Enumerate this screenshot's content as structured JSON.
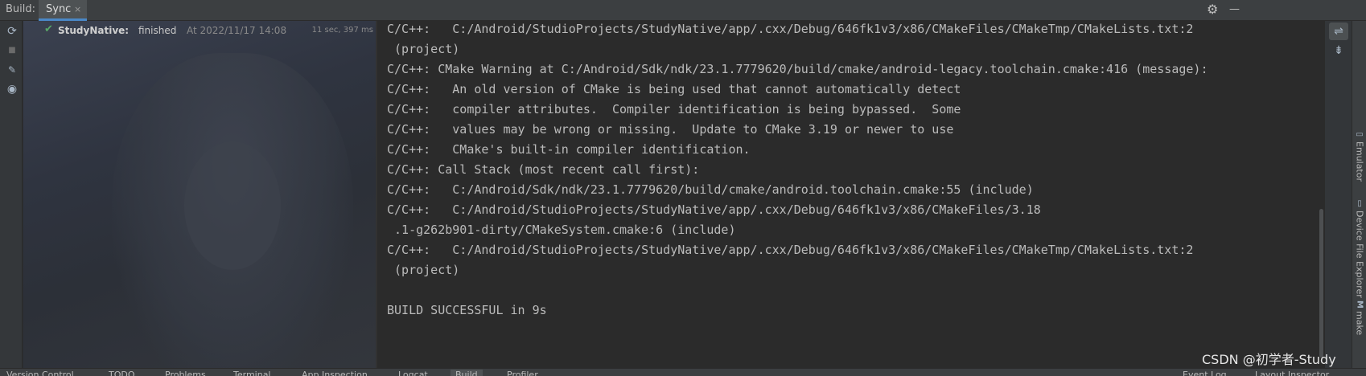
{
  "header": {
    "title": "Build:",
    "tab_label": "Sync",
    "tab_close": "×",
    "settings_icon": "⚙",
    "minimize_icon": "—"
  },
  "left_toolbar": {
    "icons": [
      "sync-icon",
      "stop-icon",
      "pin-icon",
      "eye-icon"
    ],
    "glyphs": [
      "⟳",
      "■",
      "📌",
      "👁"
    ]
  },
  "tree": {
    "check": "✔",
    "project": "StudyNative:",
    "status": "finished",
    "timestamp": "At 2022/11/17 14:08",
    "duration": "11 sec, 397 ms"
  },
  "console": {
    "lines": [
      "C/C++:   C:/Android/StudioProjects/StudyNative/app/.cxx/Debug/646fk1v3/x86/CMakeFiles/CMakeTmp/CMakeLists.txt:2",
      " (project)",
      "C/C++: CMake Warning at C:/Android/Sdk/ndk/23.1.7779620/build/cmake/android-legacy.toolchain.cmake:416 (message):",
      "C/C++:   An old version of CMake is being used that cannot automatically detect",
      "C/C++:   compiler attributes.  Compiler identification is being bypassed.  Some",
      "C/C++:   values may be wrong or missing.  Update to CMake 3.19 or newer to use",
      "C/C++:   CMake's built-in compiler identification.",
      "C/C++: Call Stack (most recent call first):",
      "C/C++:   C:/Android/Sdk/ndk/23.1.7779620/build/cmake/android.toolchain.cmake:55 (include)",
      "C/C++:   C:/Android/StudioProjects/StudyNative/app/.cxx/Debug/646fk1v3/x86/CMakeFiles/3.18",
      " .1-g262b901-dirty/CMakeSystem.cmake:6 (include)",
      "C/C++:   C:/Android/StudioProjects/StudyNative/app/.cxx/Debug/646fk1v3/x86/CMakeFiles/CMakeTmp/CMakeLists.txt:2",
      " (project)",
      "",
      "BUILD SUCCESSFUL in 9s"
    ]
  },
  "right_mini": {
    "soft_wrap_icon": "⇌",
    "scroll_to_end_icon": "⇟"
  },
  "side_tabs": {
    "emulator": "Emulator",
    "device_file_explorer": "Device File Explorer",
    "make": "make"
  },
  "bottom_tabs": [
    "Version Control",
    "TODO",
    "Problems",
    "Terminal",
    "App Inspection",
    "Logcat",
    "Build",
    "Profiler",
    "Event Log",
    "Layout Inspector"
  ],
  "watermark": "CSDN @初学者-Study"
}
